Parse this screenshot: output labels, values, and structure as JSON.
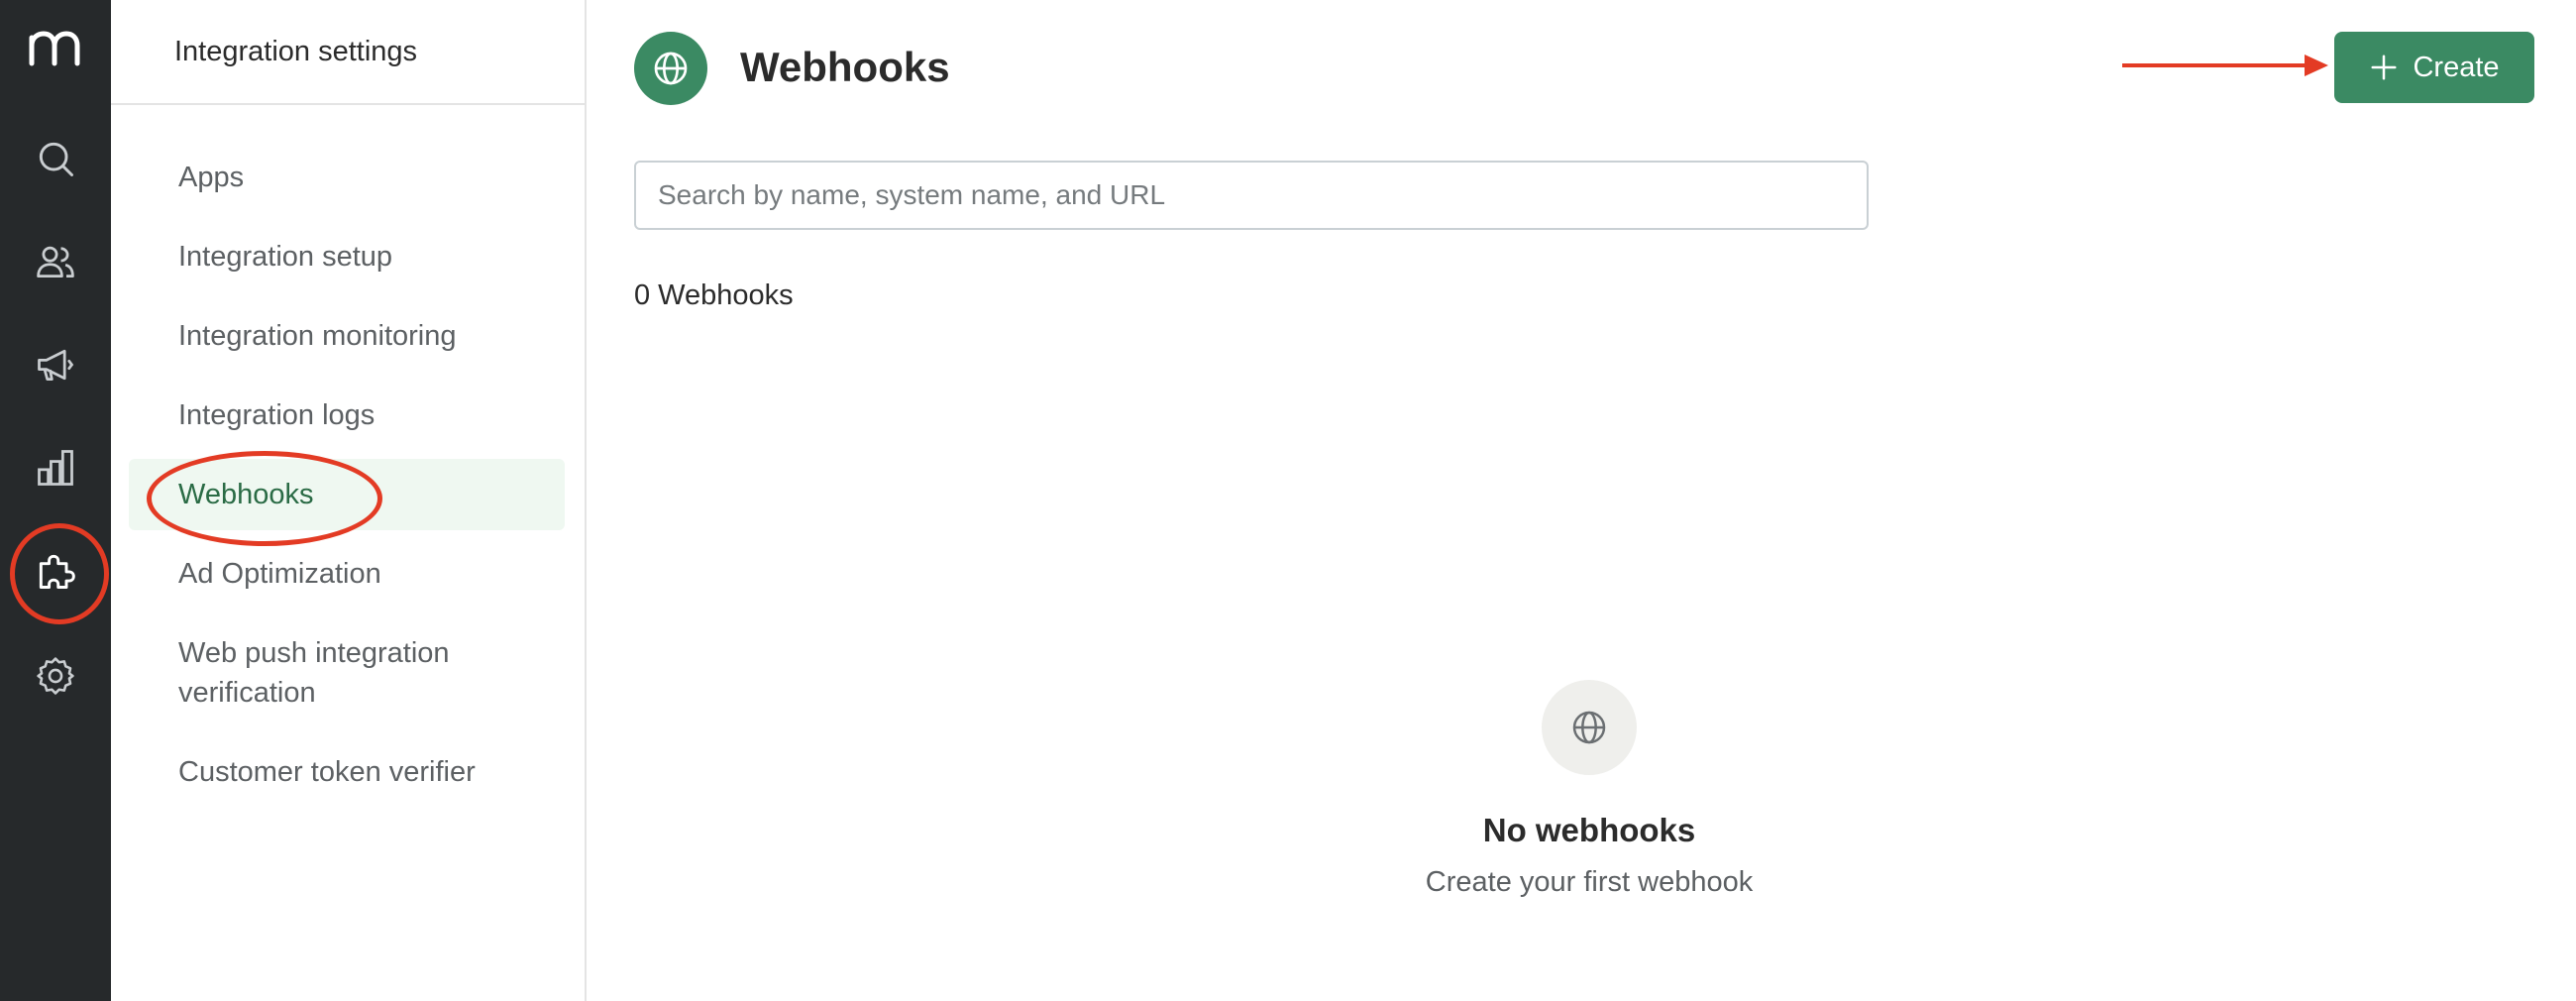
{
  "rail": {
    "logo": "m",
    "items": [
      {
        "icon": "search-icon"
      },
      {
        "icon": "users-icon"
      },
      {
        "icon": "megaphone-icon"
      },
      {
        "icon": "bar-chart-icon"
      },
      {
        "icon": "puzzle-icon",
        "active": true
      },
      {
        "icon": "gear-icon"
      }
    ]
  },
  "sidebar": {
    "title": "Integration settings",
    "items": [
      {
        "label": "Apps"
      },
      {
        "label": "Integration setup"
      },
      {
        "label": "Integration monitoring"
      },
      {
        "label": "Integration logs"
      },
      {
        "label": "Webhooks",
        "active": true
      },
      {
        "label": "Ad Optimization"
      },
      {
        "label": "Web push integration verification"
      },
      {
        "label": "Customer token verifier"
      }
    ]
  },
  "header": {
    "title": "Webhooks",
    "icon": "globe-icon",
    "create_label": "Create"
  },
  "search": {
    "placeholder": "Search by name, system name, and URL",
    "value": ""
  },
  "list": {
    "count_text": "0 Webhooks"
  },
  "empty_state": {
    "icon": "globe-icon",
    "title": "No webhooks",
    "subtitle": "Create your first webhook"
  },
  "colors": {
    "rail_bg": "#26292b",
    "accent_green": "#3b8a63",
    "active_item_bg": "#eff8f1",
    "annotation_red": "#e33b24"
  }
}
